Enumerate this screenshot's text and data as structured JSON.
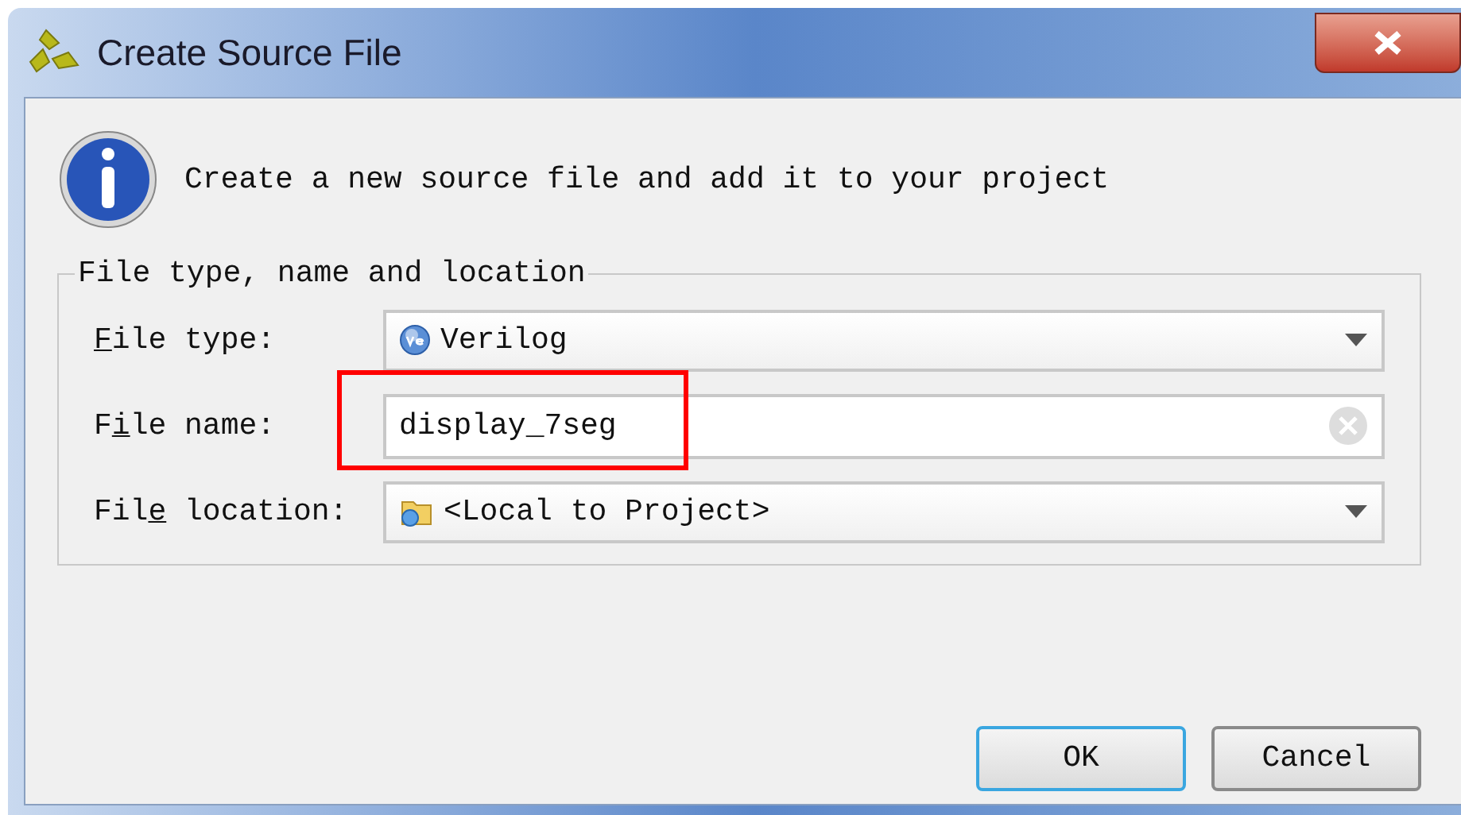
{
  "window": {
    "title": "Create Source File"
  },
  "message": "Create a new source file and add it to your project",
  "group": {
    "title": "File type, name and location",
    "rows": [
      {
        "kind": "language",
        "label": {
          "key": "F",
          "after": "ile type:"
        },
        "value": "Verilog"
      },
      {
        "kind": "text",
        "label": {
          "before": "F",
          "key": "i",
          "after": "le name:"
        },
        "value": "display_7seg",
        "highlighted": true
      },
      {
        "kind": "location",
        "label": {
          "before": "Fil",
          "key": "e",
          "after": " location:"
        },
        "value": "<Local to Project>"
      }
    ]
  },
  "buttons": [
    {
      "label": "OK",
      "default": true
    },
    {
      "label": "Cancel",
      "default": false
    }
  ]
}
